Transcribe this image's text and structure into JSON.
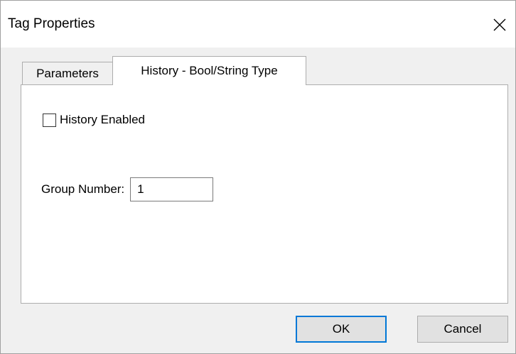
{
  "window": {
    "title": "Tag Properties"
  },
  "tabs": [
    {
      "label": "Parameters",
      "active": false
    },
    {
      "label": "History - Bool/String Type",
      "active": true
    }
  ],
  "panel": {
    "history_enabled": {
      "label": "History Enabled",
      "checked": false
    },
    "group_number": {
      "label": "Group Number:",
      "value": "1"
    }
  },
  "buttons": {
    "ok": "OK",
    "cancel": "Cancel"
  },
  "colors": {
    "focus_border": "#0078d7",
    "button_face": "#e1e1e1",
    "dialog_bg": "#f0f0f0"
  },
  "icons": {
    "close": "close-icon"
  }
}
